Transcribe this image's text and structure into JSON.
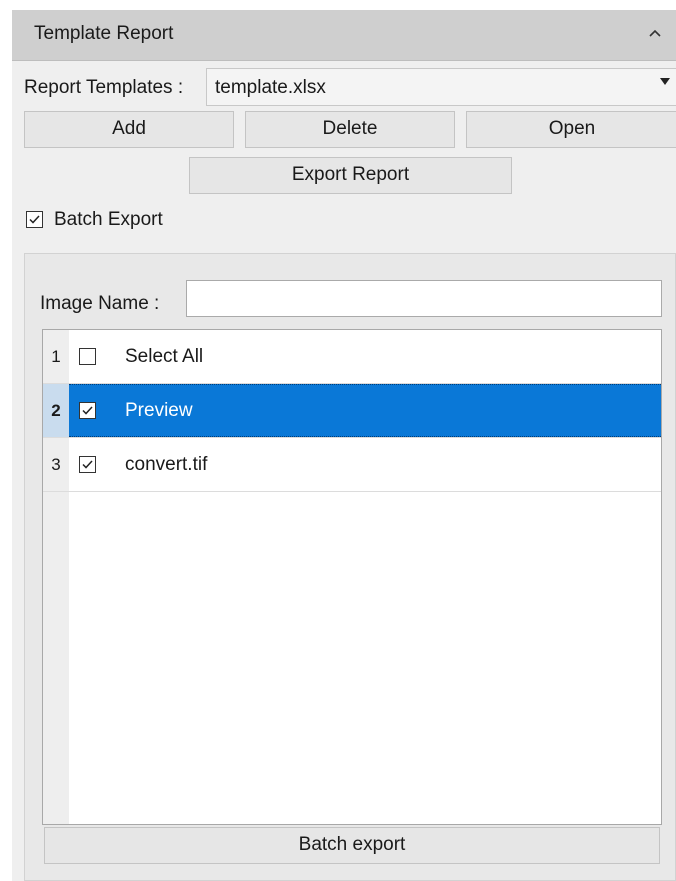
{
  "panel": {
    "title": "Template Report",
    "collapse_icon": "chevron-up-icon"
  },
  "templates": {
    "label": "Report Templates :",
    "selected": "template.xlsx"
  },
  "buttons": {
    "add": "Add",
    "delete": "Delete",
    "open": "Open",
    "export_report": "Export Report",
    "batch_export": "Batch export"
  },
  "batch_export_checkbox": {
    "label": "Batch Export",
    "checked": true
  },
  "image_name": {
    "label": "Image Name :",
    "value": ""
  },
  "list": {
    "rows": [
      {
        "num": "1",
        "label": "Select All",
        "checked": false,
        "selected": false
      },
      {
        "num": "2",
        "label": "Preview",
        "checked": true,
        "selected": true
      },
      {
        "num": "3",
        "label": "convert.tif",
        "checked": true,
        "selected": false
      }
    ]
  },
  "colors": {
    "selection": "#0a78d7",
    "header": "#cfcfcf"
  }
}
